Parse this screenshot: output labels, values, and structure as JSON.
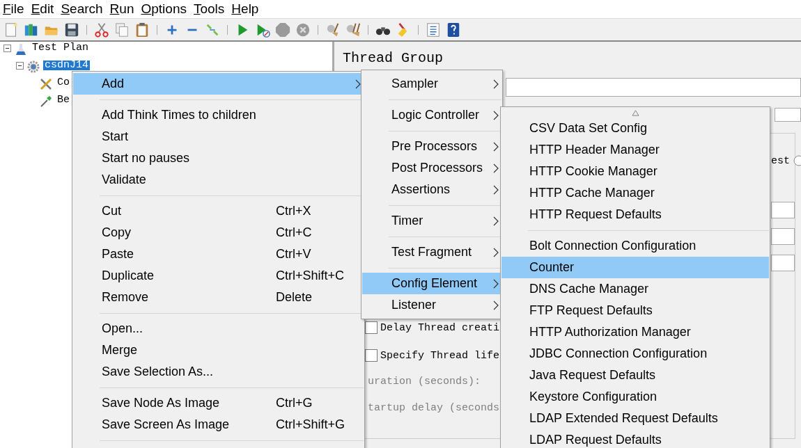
{
  "menu_bar": [
    {
      "label": "File"
    },
    {
      "label": "Edit"
    },
    {
      "label": "Search"
    },
    {
      "label": "Run"
    },
    {
      "label": "Options"
    },
    {
      "label": "Tools"
    },
    {
      "label": "Help"
    }
  ],
  "tree": [
    {
      "label": "Test Plan",
      "kind": "flask",
      "expanded": true,
      "selected": false,
      "children": [
        {
          "label": "csdnJ14",
          "kind": "gear",
          "expanded": true,
          "selected": true,
          "children": [
            {
              "label": "Co",
              "kind": "tools",
              "selected": false
            },
            {
              "label": "Be",
              "kind": "dropper",
              "selected": false
            }
          ]
        }
      ]
    }
  ],
  "panel": {
    "title": "Thread Group",
    "radio": {
      "label": "est",
      "selected": false
    },
    "checkboxes": [
      {
        "label": "Delay Thread creati",
        "checked": false
      },
      {
        "label": "Specify Thread life",
        "checked": false
      }
    ],
    "labels": [
      {
        "text": "uration (seconds):",
        "disabled": true
      },
      {
        "text": "tartup delay (seconds",
        "disabled": true
      }
    ]
  },
  "context_menu": {
    "items": [
      {
        "kind": "item",
        "label": "Add",
        "submenu": true,
        "selected": true
      },
      {
        "kind": "separator"
      },
      {
        "kind": "item",
        "label": "Add Think Times to children",
        "submenu": false,
        "selected": false
      },
      {
        "kind": "item",
        "label": "Start",
        "submenu": false,
        "selected": false
      },
      {
        "kind": "item",
        "label": "Start no pauses",
        "submenu": false,
        "selected": false
      },
      {
        "kind": "item",
        "label": "Validate",
        "submenu": false,
        "selected": false
      },
      {
        "kind": "separator"
      },
      {
        "kind": "item",
        "label": "Cut",
        "shortcut": "Ctrl+X",
        "submenu": false,
        "selected": false
      },
      {
        "kind": "item",
        "label": "Copy",
        "shortcut": "Ctrl+C",
        "submenu": false,
        "selected": false
      },
      {
        "kind": "item",
        "label": "Paste",
        "shortcut": "Ctrl+V",
        "submenu": false,
        "selected": false
      },
      {
        "kind": "item",
        "label": "Duplicate",
        "shortcut": "Ctrl+Shift+C",
        "submenu": false,
        "selected": false
      },
      {
        "kind": "item",
        "label": "Remove",
        "shortcut": "Delete",
        "submenu": false,
        "selected": false
      },
      {
        "kind": "separator"
      },
      {
        "kind": "item",
        "label": "Open...",
        "submenu": false,
        "selected": false
      },
      {
        "kind": "item",
        "label": "Merge",
        "submenu": false,
        "selected": false
      },
      {
        "kind": "item",
        "label": "Save Selection As...",
        "submenu": false,
        "selected": false
      },
      {
        "kind": "separator"
      },
      {
        "kind": "item",
        "label": "Save Node As Image",
        "shortcut": "Ctrl+G",
        "submenu": false,
        "selected": false
      },
      {
        "kind": "item",
        "label": "Save Screen As Image",
        "shortcut": "Ctrl+Shift+G",
        "submenu": false,
        "selected": false
      },
      {
        "kind": "separator"
      }
    ]
  },
  "add_menu": {
    "items": [
      {
        "kind": "item",
        "label": "Sampler",
        "submenu": true,
        "selected": false
      },
      {
        "kind": "separator"
      },
      {
        "kind": "item",
        "label": "Logic Controller",
        "submenu": true,
        "selected": false
      },
      {
        "kind": "separator"
      },
      {
        "kind": "item",
        "label": "Pre Processors",
        "submenu": true,
        "selected": false
      },
      {
        "kind": "item",
        "label": "Post Processors",
        "submenu": true,
        "selected": false
      },
      {
        "kind": "item",
        "label": "Assertions",
        "submenu": true,
        "selected": false
      },
      {
        "kind": "separator"
      },
      {
        "kind": "item",
        "label": "Timer",
        "submenu": true,
        "selected": false
      },
      {
        "kind": "separator"
      },
      {
        "kind": "item",
        "label": "Test Fragment",
        "submenu": true,
        "selected": false
      },
      {
        "kind": "separator"
      },
      {
        "kind": "item",
        "label": "Config Element",
        "submenu": true,
        "selected": true
      },
      {
        "kind": "item",
        "label": "Listener",
        "submenu": true,
        "selected": false
      }
    ]
  },
  "config_menu": {
    "scroll_up": true,
    "items": [
      {
        "kind": "item",
        "label": "CSV Data Set Config",
        "selected": false
      },
      {
        "kind": "item",
        "label": "HTTP Header Manager",
        "selected": false
      },
      {
        "kind": "item",
        "label": "HTTP Cookie Manager",
        "selected": false
      },
      {
        "kind": "item",
        "label": "HTTP Cache Manager",
        "selected": false
      },
      {
        "kind": "item",
        "label": "HTTP Request Defaults",
        "selected": false
      },
      {
        "kind": "separator"
      },
      {
        "kind": "item",
        "label": "Bolt Connection Configuration",
        "selected": false
      },
      {
        "kind": "item",
        "label": "Counter",
        "selected": true
      },
      {
        "kind": "item",
        "label": "DNS Cache Manager",
        "selected": false
      },
      {
        "kind": "item",
        "label": "FTP Request Defaults",
        "selected": false
      },
      {
        "kind": "item",
        "label": "HTTP Authorization Manager",
        "selected": false
      },
      {
        "kind": "item",
        "label": "JDBC Connection Configuration",
        "selected": false
      },
      {
        "kind": "item",
        "label": "Java Request Defaults",
        "selected": false
      },
      {
        "kind": "item",
        "label": "Keystore Configuration",
        "selected": false
      },
      {
        "kind": "item",
        "label": "LDAP Extended Request Defaults",
        "selected": false
      },
      {
        "kind": "item",
        "label": "LDAP Request Defaults",
        "selected": false
      }
    ]
  }
}
